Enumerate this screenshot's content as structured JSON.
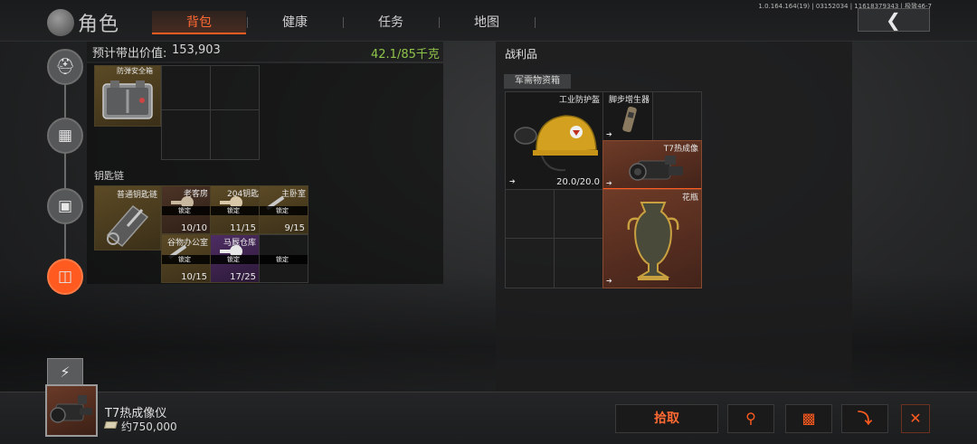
{
  "header": {
    "title": "角色",
    "tabs": [
      {
        "label": "背包",
        "active": true
      },
      {
        "label": "健康",
        "active": false
      },
      {
        "label": "任务",
        "active": false
      },
      {
        "label": "地图",
        "active": false
      }
    ],
    "version": "1.0.164.164(19) | 03152034 | 11618379343 | 极致46-7",
    "back_icon": "chevron-left-icon"
  },
  "sidebar": {
    "items": [
      {
        "icon": "helmet-icon"
      },
      {
        "icon": "vest-icon"
      },
      {
        "icon": "backpack-icon"
      },
      {
        "icon": "case-icon",
        "active": true
      }
    ],
    "energy_icon": "lightning-icon"
  },
  "backpack": {
    "estimate_label": "预计带出价值:",
    "estimate_value": "153,903",
    "weight": "42.1/85千克",
    "safe_box_label": "防弹安全箱",
    "keychain_section": "钥匙链",
    "keychain_label": "普通钥匙链",
    "keys": [
      {
        "name": "老客房",
        "lock": "锁定",
        "count": "10/10",
        "rarity": "brown"
      },
      {
        "name": "204钥匙",
        "lock": "锁定",
        "count": "11/15",
        "rarity": "gold"
      },
      {
        "name": "主卧室",
        "lock": "锁定",
        "count": "9/15",
        "rarity": "gold"
      },
      {
        "name": "谷物办公室",
        "lock": "锁定",
        "count": "10/15",
        "rarity": "gold"
      },
      {
        "name": "马厩仓库",
        "lock": "锁定",
        "count": "17/25",
        "rarity": "purple"
      },
      {
        "name": "",
        "lock": "锁定",
        "count": "",
        "rarity": "empty"
      }
    ]
  },
  "loot": {
    "title": "战利品",
    "container_tab": "军需物资箱",
    "items": [
      {
        "name": "工业防护盔",
        "durability": "20.0/20.0"
      },
      {
        "name": "脚步增生器"
      },
      {
        "name": "T7热成像"
      },
      {
        "name": "花瓶"
      }
    ]
  },
  "selected": {
    "name": "T7热成像仪",
    "price": "约750,000"
  },
  "actions": {
    "pickup": "拾取",
    "search_icon": "search-icon",
    "box_icon": "crate-icon",
    "down_icon": "arrow-down-icon",
    "close_icon": "close-icon"
  },
  "colors": {
    "accent": "#ff5a1f",
    "weight_green": "#8fc44a",
    "gold_rarity": "#5c4a25",
    "orange_rarity": "#6a3a28",
    "purple_rarity": "#4e2d63"
  }
}
